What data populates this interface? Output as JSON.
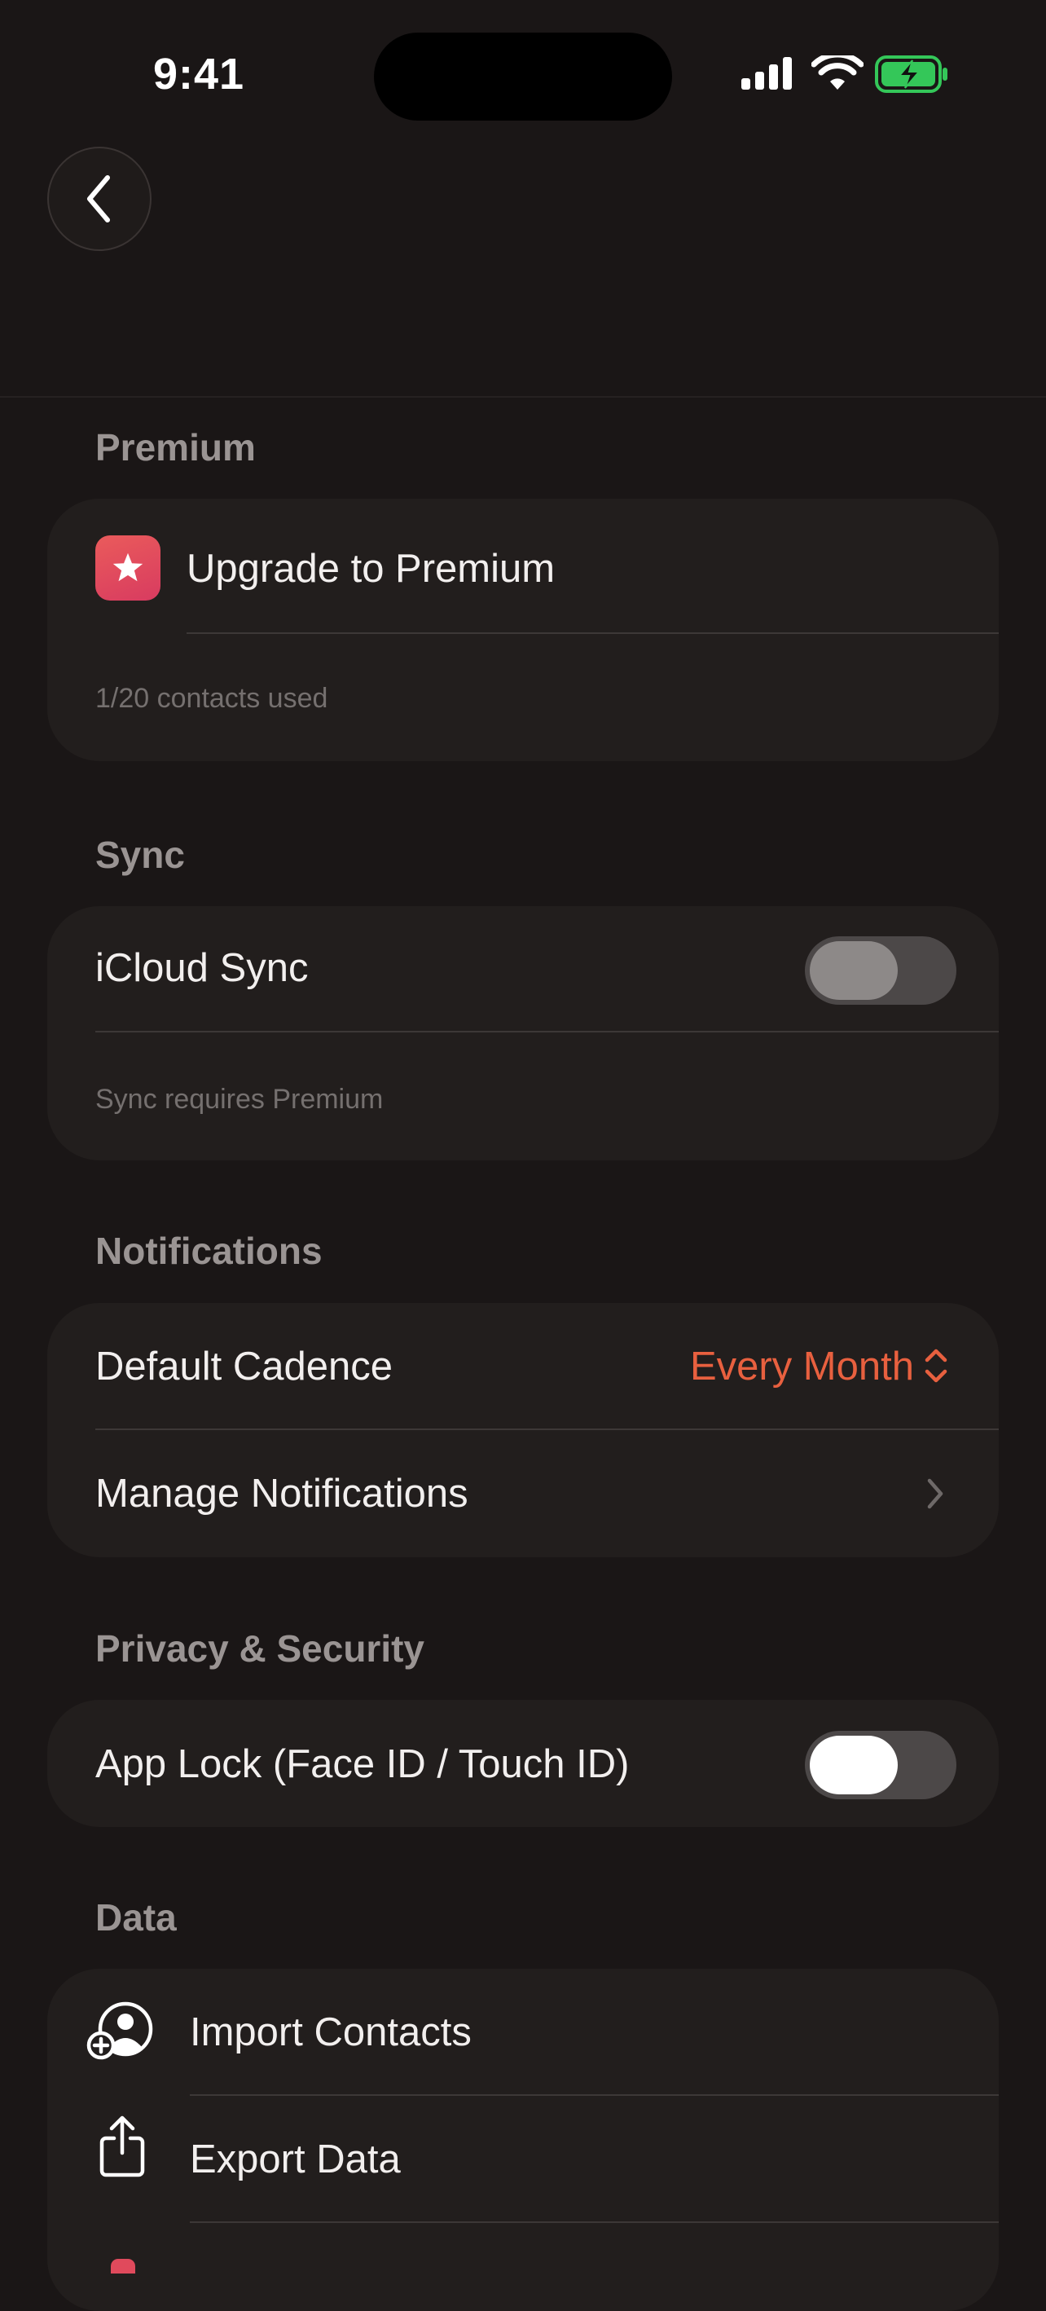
{
  "status_bar": {
    "time": "9:41"
  },
  "nav": {
    "back_icon": "chevron-left-icon"
  },
  "sections": {
    "premium": {
      "header": "Premium",
      "upgrade_label": "Upgrade to Premium",
      "upgrade_icon": "star-icon",
      "footnote": "1/20 contacts used"
    },
    "sync": {
      "header": "Sync",
      "icloud_label": "iCloud Sync",
      "icloud_enabled": false,
      "footnote": "Sync requires Premium"
    },
    "notifications": {
      "header": "Notifications",
      "cadence_label": "Default Cadence",
      "cadence_value": "Every Month",
      "manage_label": "Manage Notifications"
    },
    "privacy": {
      "header": "Privacy & Security",
      "app_lock_label": "App Lock (Face ID / Touch ID)",
      "app_lock_enabled": false
    },
    "data": {
      "header": "Data",
      "import_label": "Import Contacts",
      "export_label": "Export Data"
    }
  },
  "colors": {
    "background": "#1a1616",
    "card": "#221e1d",
    "accent": "#e8603f",
    "premium_icon": "#e04a5c",
    "battery": "#34c759"
  }
}
